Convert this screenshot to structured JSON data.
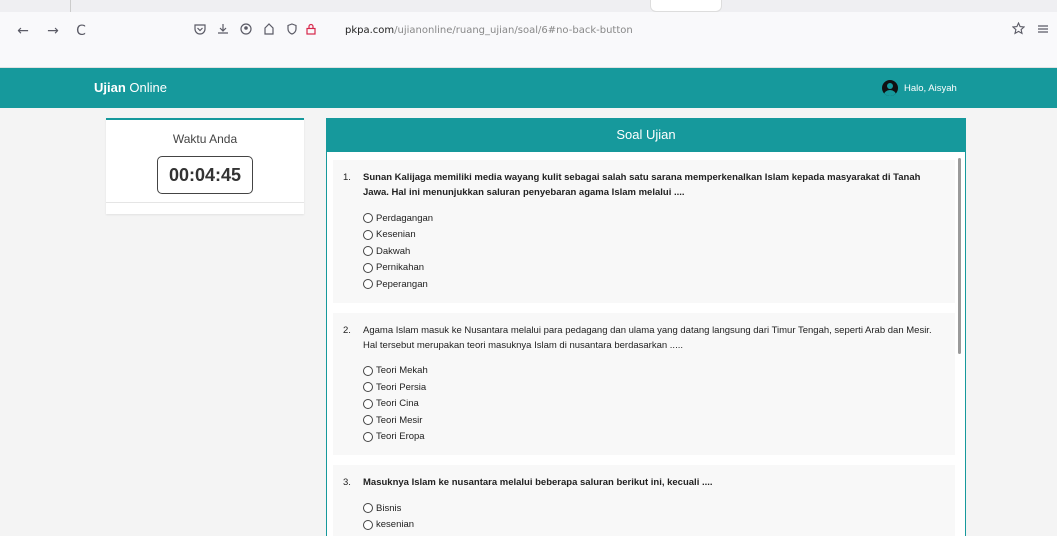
{
  "browser": {
    "nav": {
      "back": "←",
      "forward": "→",
      "reload": "C"
    },
    "url_host": "pkpa.com",
    "url_path": "/ujianonline/ruang_ujian/soal/6#no-back-button",
    "icons": [
      "pocket-icon",
      "download-icon",
      "account-icon",
      "extensions-icon",
      "shield-icon",
      "lock-icon",
      "bookmark-star-icon",
      "menu-icon"
    ]
  },
  "app": {
    "brand_bold": "Ujian",
    "brand_rest": " Online",
    "user_greeting": "Halo, Aisyah",
    "accent_color": "#16999c"
  },
  "timer": {
    "title": "Waktu Anda",
    "value": "00:04:45"
  },
  "panel": {
    "title": "Soal Ujian"
  },
  "questions": [
    {
      "number": "1.",
      "bold": true,
      "lines": [
        "Sunan Kalijaga memiliki media wayang kulit sebagai salah satu sarana memperkenalkan Islam kepada masyarakat di Tanah Jawa. Hal ini menunjukkan saluran penyebaran agama Islam melalui ...."
      ],
      "options": [
        "Perdagangan",
        "Kesenian",
        "Dakwah",
        "Pernikahan",
        "Peperangan"
      ]
    },
    {
      "number": "2.",
      "bold": false,
      "lines": [
        "Agama Islam masuk ke Nusantara melalui para pedagang dan ulama yang datang langsung dari Timur Tengah, seperti Arab dan Mesir.",
        "Hal tersebut merupakan teori masuknya Islam di nusantara berdasarkan ....."
      ],
      "options": [
        "Teori Mekah",
        "Teori Persia",
        "Teori Cina",
        "Teori Mesir",
        "Teori Eropa"
      ]
    },
    {
      "number": "3.",
      "bold": true,
      "lines": [
        "Masuknya Islam ke nusantara melalui beberapa saluran berikut ini, kecuali ...."
      ],
      "options": [
        "Bisnis",
        "kesenian"
      ]
    }
  ]
}
